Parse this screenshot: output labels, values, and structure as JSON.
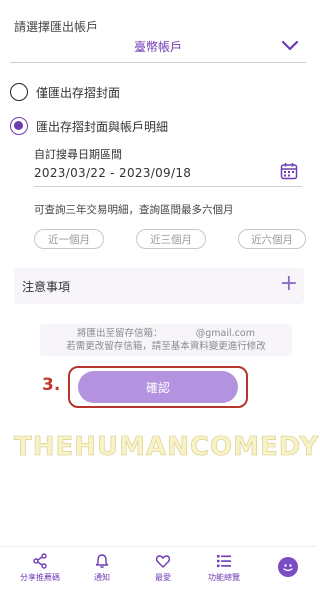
{
  "account": {
    "label": "請選擇匯出帳戶",
    "value": "臺幣帳戶"
  },
  "options": [
    {
      "label": "僅匯出存摺封面",
      "selected": false
    },
    {
      "label": "匯出存摺封面與帳戶明細",
      "selected": true
    }
  ],
  "date": {
    "label": "自訂搜尋日期區間",
    "range": "2023/03/22 - 2023/09/18"
  },
  "hint": "可查詢三年交易明細，查詢區間最多六個月",
  "quick_ranges": [
    "近一個月",
    "近三個月",
    "近六個月"
  ],
  "notes": {
    "title": "注意事項"
  },
  "info": {
    "line1": "將匯出至留存信箱：　　　　@gmail.com",
    "line2": "若需更改留存信箱，請至基本資料變更進行修改"
  },
  "step_marker": "3.",
  "confirm_label": "確認",
  "watermark": "THEHUMANCOMEDY",
  "nav": [
    {
      "label": "分享推薦碼",
      "icon": "share-icon"
    },
    {
      "label": "通知",
      "icon": "bell-icon"
    },
    {
      "label": "最愛",
      "icon": "heart-icon"
    },
    {
      "label": "功能總覽",
      "icon": "menu-icon"
    },
    {
      "label": "",
      "icon": "avatar-icon"
    }
  ],
  "colors": {
    "accent": "#6f3bb4",
    "button": "#b393e0",
    "highlight": "#b5352e"
  }
}
